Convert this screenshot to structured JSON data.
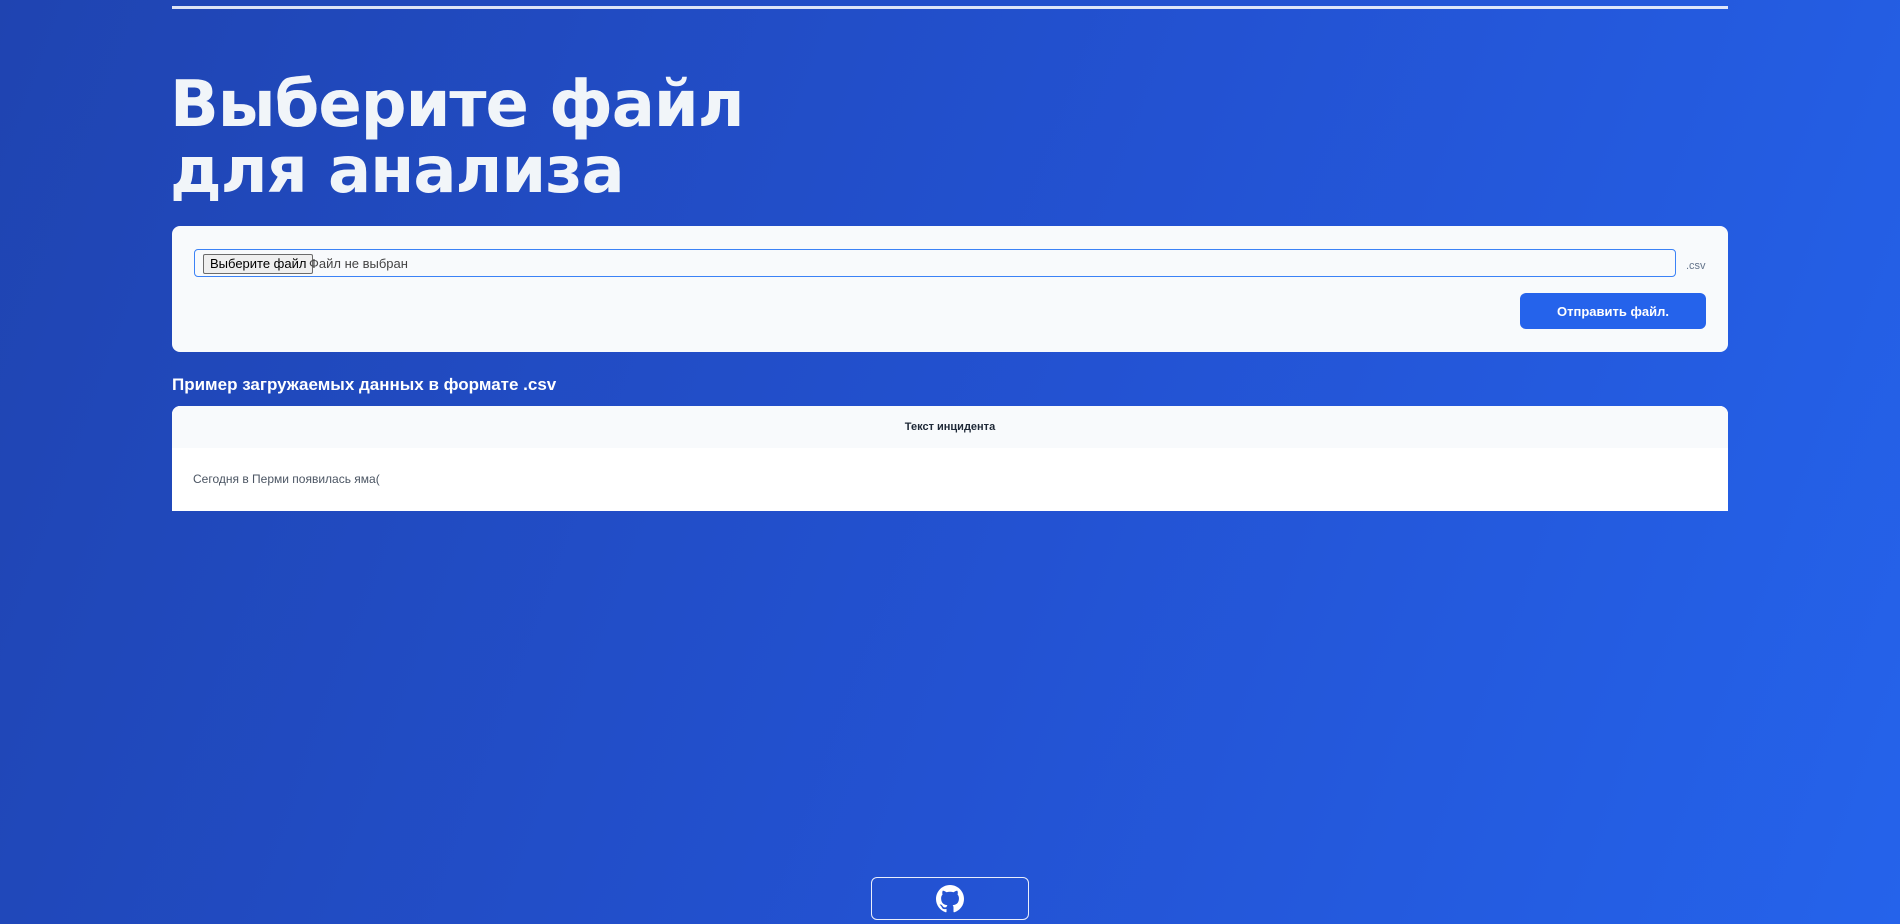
{
  "page": {
    "title": "Выберите файл для анализа"
  },
  "upload": {
    "choose_button_label": "Выберите файл",
    "file_status": "Файл не выбран",
    "extension_hint": ".csv",
    "submit_label": "Отправить файл."
  },
  "example": {
    "heading": "Пример загружаемых данных в формате .csv",
    "columns": [
      "Текст инцидента"
    ],
    "rows": [
      [
        "Сегодня в Перми появилась яма("
      ]
    ]
  },
  "footer": {
    "github_icon": "github-icon"
  },
  "colors": {
    "background_start": "#1f44b1",
    "background_end": "#2563eb",
    "accent": "#2563eb",
    "card": "#f8fafc"
  }
}
